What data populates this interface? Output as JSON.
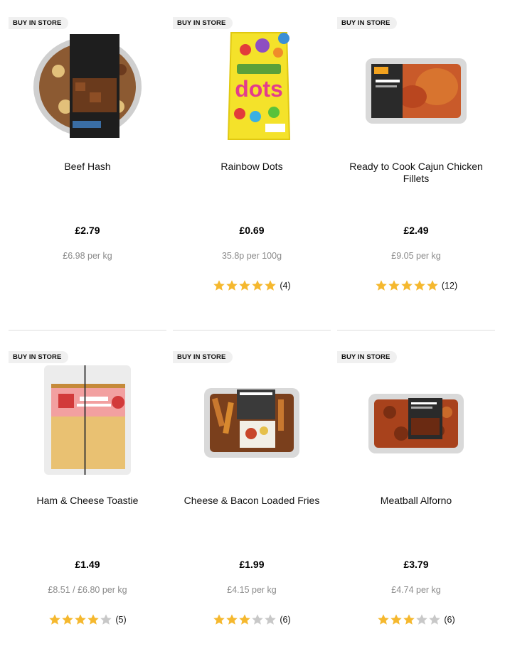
{
  "badge_label": "BUY IN STORE",
  "colors": {
    "star_filled": "#f5b82e",
    "star_empty": "#c8c8c8",
    "unit_text": "#8a8a8a",
    "badge_bg": "#f0f0f0"
  },
  "products": [
    {
      "name": "Beef Hash",
      "price": "£2.79",
      "unit_price": "£6.98 per kg",
      "rating": null,
      "review_count": "",
      "icon": "beef-hash-tray"
    },
    {
      "name": "Rainbow Dots",
      "price": "£0.69",
      "unit_price": "35.8p per 100g",
      "rating": 5,
      "review_count": "(4)",
      "icon": "sweets-pouch"
    },
    {
      "name": "Ready to Cook Cajun Chicken Fillets",
      "price": "£2.49",
      "unit_price": "£9.05 per kg",
      "rating": 5,
      "review_count": "(12)",
      "icon": "chicken-tray"
    },
    {
      "name": "Ham & Cheese Toastie",
      "price": "£1.49",
      "unit_price": "£8.51 / £6.80 per kg",
      "rating": 4,
      "review_count": "(5)",
      "icon": "toastie-pack"
    },
    {
      "name": "Cheese & Bacon Loaded Fries",
      "price": "£1.99",
      "unit_price": "£4.15 per kg",
      "rating": 3,
      "review_count": "(6)",
      "icon": "fries-tray"
    },
    {
      "name": "Meatball Alforno",
      "price": "£3.79",
      "unit_price": "£4.74 per kg",
      "rating": 3,
      "review_count": "(6)",
      "icon": "meatball-tray"
    }
  ],
  "max_rating": 5
}
